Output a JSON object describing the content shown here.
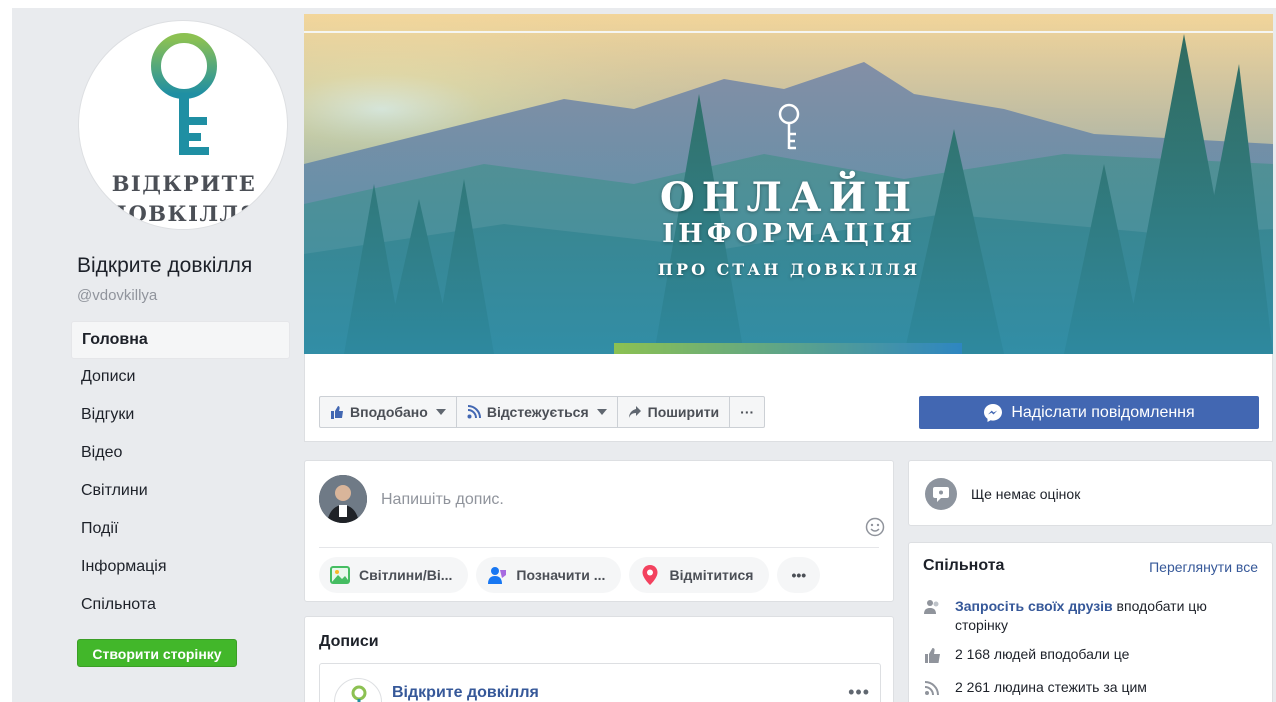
{
  "page": {
    "logo_line1": "ВІДКРИТЕ",
    "logo_line2": "ДОВКІЛЛЯ",
    "name": "Відкрите довкілля",
    "handle": "@vdovkillya"
  },
  "sidebar": {
    "items": [
      {
        "label": "Головна",
        "active": true
      },
      {
        "label": "Дописи"
      },
      {
        "label": "Відгуки"
      },
      {
        "label": "Відео"
      },
      {
        "label": "Світлини"
      },
      {
        "label": "Події"
      },
      {
        "label": "Інформація"
      },
      {
        "label": "Спільнота"
      }
    ],
    "create_page": "Створити сторінку"
  },
  "cover": {
    "line1": "ОНЛАЙН",
    "line2": "ІНФОРМАЦІЯ",
    "line3": "ПРО СТАН ДОВКІЛЛЯ"
  },
  "actions": {
    "liked": "Вподобано",
    "following": "Відстежується",
    "share": "Поширити",
    "more": "···",
    "message": "Надіслати повідомлення"
  },
  "composer": {
    "placeholder": "Напишіть допис.",
    "photo": "Світлини/Ві...",
    "tag": "Позначити ...",
    "checkin": "Відмітитися",
    "more": "•••"
  },
  "posts": {
    "title": "Дописи",
    "author": "Відкрите довкілля",
    "more": "•••"
  },
  "reviews": {
    "text": "Ще немає оцінок"
  },
  "community": {
    "title": "Спільнота",
    "see_all": "Переглянути все",
    "invite_link": "Запросіть своїх друзів",
    "invite_rest": " вподобати цю сторінку",
    "likes": "2 168 людей вподобали це",
    "follows": "2 261 людина стежить за цим"
  },
  "colors": {
    "brand_blue": "#4267b2",
    "link_blue": "#365899",
    "green_button": "#42b72a",
    "logo_teal": "#2a9d8f",
    "logo_green": "#8cc152"
  },
  "icons": {
    "like": "thumbs-up-icon",
    "follow": "rss-icon",
    "share": "share-arrow-icon",
    "messenger": "messenger-icon",
    "photo": "photo-icon",
    "tag": "tag-people-icon",
    "checkin": "location-pin-icon",
    "emoji": "smiley-icon",
    "reviews": "speech-bubble-icon",
    "invite": "people-icon",
    "likes": "thumbs-up-icon",
    "follows": "rss-icon"
  }
}
